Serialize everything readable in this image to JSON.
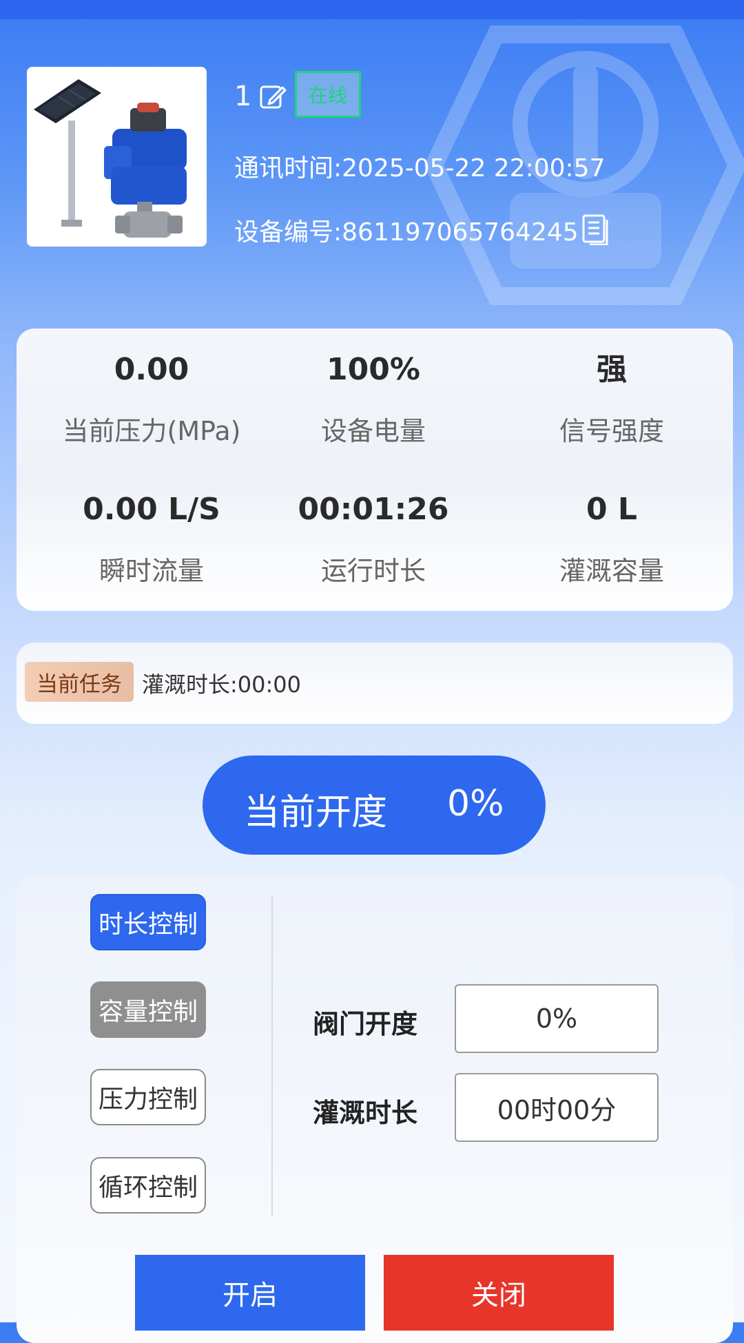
{
  "device": {
    "name": "1",
    "status": "在线",
    "comm_time_label": "通讯时间:",
    "comm_time": "2025-05-22 22:00:57",
    "serial_label": "设备编号:",
    "serial": "861197065764245"
  },
  "stats": [
    {
      "value": "0.00",
      "label": "当前压力(MPa)"
    },
    {
      "value": "100%",
      "label": "设备电量"
    },
    {
      "value": "强",
      "label": "信号强度"
    },
    {
      "value": "0.00 L/S",
      "label": "瞬时流量"
    },
    {
      "value": "00:01:26",
      "label": "运行时长"
    },
    {
      "value": "0 L",
      "label": "灌溉容量"
    }
  ],
  "task": {
    "tag": "当前任务",
    "text": "灌溉时长:00:00"
  },
  "opening": {
    "label": "当前开度",
    "value": "0%"
  },
  "modes": [
    "时长控制",
    "容量控制",
    "压力控制",
    "循环控制"
  ],
  "fields": {
    "valve_label": "阀门开度",
    "valve_value": "0%",
    "duration_label": "灌溉时长",
    "duration_value": "00时00分"
  },
  "actions": {
    "open": "开启",
    "close": "关闭"
  },
  "colors": {
    "primary": "#2d68ef",
    "danger": "#e8352a",
    "online": "#1ed47c",
    "disabled": "#8f8f8f"
  }
}
